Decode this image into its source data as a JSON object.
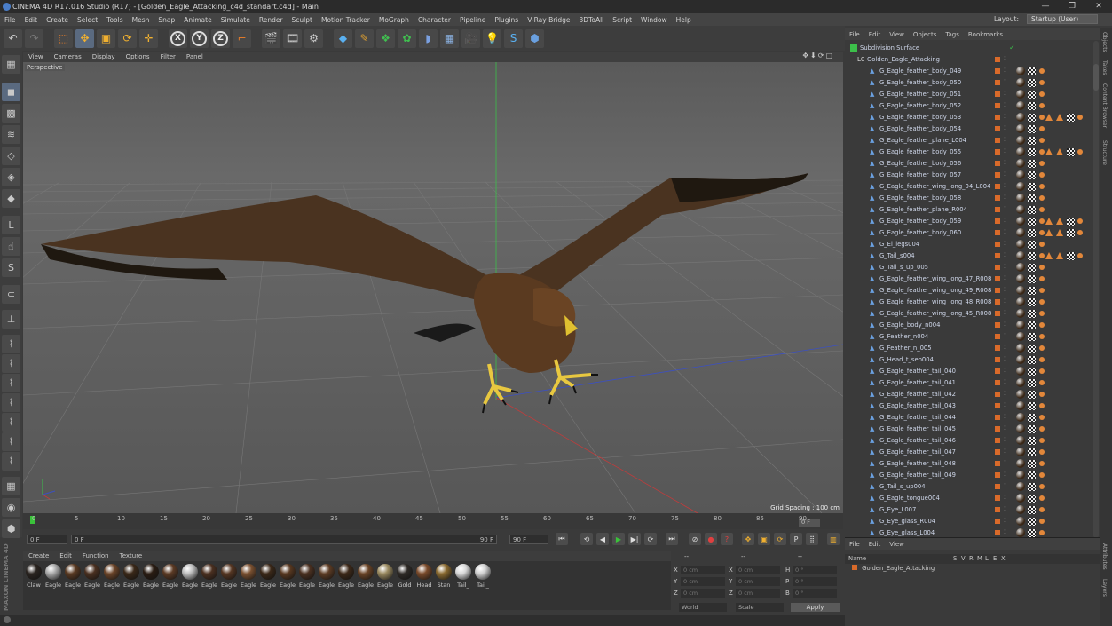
{
  "app": {
    "title": "CINEMA 4D R17.016 Studio (R17) - [Golden_Eagle_Attacking_c4d_standart.c4d] - Main",
    "window_buttons": [
      "—",
      "❐",
      "✕"
    ]
  },
  "menubar": {
    "items": [
      "File",
      "Edit",
      "Create",
      "Select",
      "Tools",
      "Mesh",
      "Snap",
      "Animate",
      "Simulate",
      "Render",
      "Sculpt",
      "Motion Tracker",
      "MoGraph",
      "Character",
      "Pipeline",
      "Plugins",
      "V-Ray Bridge",
      "3DToAll",
      "Script",
      "Window",
      "Help"
    ],
    "layout_label": "Layout:",
    "layout_value": "Startup (User)"
  },
  "viewport": {
    "menu": [
      "View",
      "Cameras",
      "Display",
      "Options",
      "Filter",
      "Panel"
    ],
    "name": "Perspective",
    "grid_spacing": "Grid Spacing : 100 cm"
  },
  "timeline": {
    "ticks": [
      "0",
      "5",
      "10",
      "15",
      "20",
      "25",
      "30",
      "35",
      "40",
      "45",
      "50",
      "55",
      "60",
      "65",
      "70",
      "75",
      "80",
      "85",
      "90"
    ],
    "current_frame": "0 F",
    "start_field": "0 F",
    "mid_field": "0 F",
    "end_field": "90 F",
    "end_field2": "90 F"
  },
  "material_manager": {
    "menu": [
      "Create",
      "Edit",
      "Function",
      "Texture"
    ],
    "materials": [
      {
        "label": "Claw",
        "color": "#2a2420"
      },
      {
        "label": "Eagle",
        "color": "#a9a9a9"
      },
      {
        "label": "Eagle",
        "color": "#5a3a22"
      },
      {
        "label": "Eagle",
        "color": "#4a3020"
      },
      {
        "label": "Eagle",
        "color": "#6b4428"
      },
      {
        "label": "Eagle",
        "color": "#3a2818"
      },
      {
        "label": "Eagle",
        "color": "#2a1c12"
      },
      {
        "label": "Eagle",
        "color": "#5b3a24"
      },
      {
        "label": "Eagle",
        "color": "#bdbdbd"
      },
      {
        "label": "Eagle",
        "color": "#4b3020"
      },
      {
        "label": "Eagle",
        "color": "#553622"
      },
      {
        "label": "Eagle",
        "color": "#7a5030"
      },
      {
        "label": "Eagle",
        "color": "#3b2818"
      },
      {
        "label": "Eagle",
        "color": "#583820"
      },
      {
        "label": "Eagle",
        "color": "#4a3020"
      },
      {
        "label": "Eagle",
        "color": "#5d3c24"
      },
      {
        "label": "Eagle",
        "color": "#3c2818"
      },
      {
        "label": "Eagle",
        "color": "#6a4426"
      },
      {
        "label": "Eagle",
        "color": "#9a8a60"
      },
      {
        "label": "Gold",
        "color": "#2e2a26"
      },
      {
        "label": "Head",
        "color": "#7a4a2a"
      },
      {
        "label": "Stan",
        "color": "#8a6a30"
      },
      {
        "label": "Tail_",
        "color": "#d8d8d8"
      },
      {
        "label": "Tail_",
        "color": "#cfcfcf"
      }
    ]
  },
  "coordinates": {
    "rows": [
      {
        "a": "X",
        "av": "0 cm",
        "b": "X",
        "bv": "0 cm",
        "c": "H",
        "cv": "0 °"
      },
      {
        "a": "Y",
        "av": "0 cm",
        "b": "Y",
        "bv": "0 cm",
        "c": "P",
        "cv": "0 °"
      },
      {
        "a": "Z",
        "av": "0 cm",
        "b": "Z",
        "bv": "0 cm",
        "c": "B",
        "cv": "0 °"
      }
    ],
    "world_label": "World",
    "scale_label": "Scale",
    "apply_label": "Apply",
    "header_dash": "--"
  },
  "object_manager": {
    "menu": [
      "File",
      "Edit",
      "View",
      "Objects",
      "Tags",
      "Bookmarks"
    ],
    "objects": [
      {
        "name": "Subdivision Surface",
        "level": 0,
        "kind": "subdiv"
      },
      {
        "name": "Golden_Eagle_Attacking",
        "level": 1,
        "kind": "null"
      },
      {
        "name": "G_Eagle_feather_body_049",
        "level": 2,
        "kind": "poly",
        "tags": "sc"
      },
      {
        "name": "G_Eagle_feather_body_050",
        "level": 2,
        "kind": "poly",
        "tags": "sc"
      },
      {
        "name": "G_Eagle_feather_body_051",
        "level": 2,
        "kind": "poly",
        "tags": "sc"
      },
      {
        "name": "G_Eagle_feather_body_052",
        "level": 2,
        "kind": "poly",
        "tags": "sc"
      },
      {
        "name": "G_Eagle_feather_body_053",
        "level": 2,
        "kind": "poly",
        "tags": "big"
      },
      {
        "name": "G_Eagle_feather_body_054",
        "level": 2,
        "kind": "poly",
        "tags": "sc"
      },
      {
        "name": "G_Eagle_feather_plane_L004",
        "level": 2,
        "kind": "poly",
        "tags": "sc"
      },
      {
        "name": "G_Eagle_feather_body_055",
        "level": 2,
        "kind": "poly",
        "tags": "big"
      },
      {
        "name": "G_Eagle_feather_body_056",
        "level": 2,
        "kind": "poly",
        "tags": "sc"
      },
      {
        "name": "G_Eagle_feather_body_057",
        "level": 2,
        "kind": "poly",
        "tags": "sc"
      },
      {
        "name": "G_Eagle_feather_wing_long_04_L004",
        "level": 2,
        "kind": "poly",
        "tags": "sc"
      },
      {
        "name": "G_Eagle_feather_body_058",
        "level": 2,
        "kind": "poly",
        "tags": "sc"
      },
      {
        "name": "G_Eagle_feather_plane_R004",
        "level": 2,
        "kind": "poly",
        "tags": "sc"
      },
      {
        "name": "G_Eagle_feather_body_059",
        "level": 2,
        "kind": "poly",
        "tags": "mid"
      },
      {
        "name": "G_Eagle_feather_body_060",
        "level": 2,
        "kind": "poly",
        "tags": "mid"
      },
      {
        "name": "G_El_legs004",
        "level": 2,
        "kind": "poly",
        "tags": "sc"
      },
      {
        "name": "G_Tail_s004",
        "level": 2,
        "kind": "poly",
        "tags": "mid"
      },
      {
        "name": "G_Tail_s_up_005",
        "level": 2,
        "kind": "poly",
        "tags": "sc"
      },
      {
        "name": "G_Eagle_feather_wing_long_47_R008",
        "level": 2,
        "kind": "poly",
        "tags": "sc"
      },
      {
        "name": "G_Eagle_feather_wing_long_49_R008",
        "level": 2,
        "kind": "poly",
        "tags": "sc"
      },
      {
        "name": "G_Eagle_feather_wing_long_48_R008",
        "level": 2,
        "kind": "poly",
        "tags": "sc"
      },
      {
        "name": "G_Eagle_feather_wing_long_45_R008",
        "level": 2,
        "kind": "poly",
        "tags": "sc"
      },
      {
        "name": "G_Eagle_body_n004",
        "level": 2,
        "kind": "poly",
        "tags": "sc"
      },
      {
        "name": "G_Feather_n004",
        "level": 2,
        "kind": "poly",
        "tags": "sc"
      },
      {
        "name": "G_Feather_n_005",
        "level": 2,
        "kind": "poly",
        "tags": "sc"
      },
      {
        "name": "G_Head_t_sep004",
        "level": 2,
        "kind": "poly",
        "tags": "sc"
      },
      {
        "name": "G_Eagle_feather_tail_040",
        "level": 2,
        "kind": "poly",
        "tags": "sc"
      },
      {
        "name": "G_Eagle_feather_tail_041",
        "level": 2,
        "kind": "poly",
        "tags": "sc"
      },
      {
        "name": "G_Eagle_feather_tail_042",
        "level": 2,
        "kind": "poly",
        "tags": "sc"
      },
      {
        "name": "G_Eagle_feather_tail_043",
        "level": 2,
        "kind": "poly",
        "tags": "sc"
      },
      {
        "name": "G_Eagle_feather_tail_044",
        "level": 2,
        "kind": "poly",
        "tags": "sc"
      },
      {
        "name": "G_Eagle_feather_tail_045",
        "level": 2,
        "kind": "poly",
        "tags": "sc"
      },
      {
        "name": "G_Eagle_feather_tail_046",
        "level": 2,
        "kind": "poly",
        "tags": "sc"
      },
      {
        "name": "G_Eagle_feather_tail_047",
        "level": 2,
        "kind": "poly",
        "tags": "sc"
      },
      {
        "name": "G_Eagle_feather_tail_048",
        "level": 2,
        "kind": "poly",
        "tags": "sc"
      },
      {
        "name": "G_Eagle_feather_tail_049",
        "level": 2,
        "kind": "poly",
        "tags": "sc"
      },
      {
        "name": "G_Tail_s_up004",
        "level": 2,
        "kind": "poly",
        "tags": "sc"
      },
      {
        "name": "G_Eagle_tongue004",
        "level": 2,
        "kind": "poly",
        "tags": "sc"
      },
      {
        "name": "G_Eye_L007",
        "level": 2,
        "kind": "poly",
        "tags": "sc"
      },
      {
        "name": "G_Eye_glass_R004",
        "level": 2,
        "kind": "poly",
        "tags": "sc"
      },
      {
        "name": "G_Eye_glass_L004",
        "level": 2,
        "kind": "poly",
        "tags": "sc"
      }
    ]
  },
  "attribute_manager": {
    "menu": [
      "File",
      "Edit",
      "View"
    ],
    "columns": [
      "Name",
      "S",
      "V",
      "R",
      "M",
      "L",
      "E",
      "X"
    ],
    "row_name": "Golden_Eagle_Attacking"
  },
  "side_tabs": [
    "Objects",
    "Takes",
    "Content Browser",
    "Structure",
    "Attributes",
    "Layers"
  ],
  "left_tools_brand": "MAXON CINEMA 4D"
}
